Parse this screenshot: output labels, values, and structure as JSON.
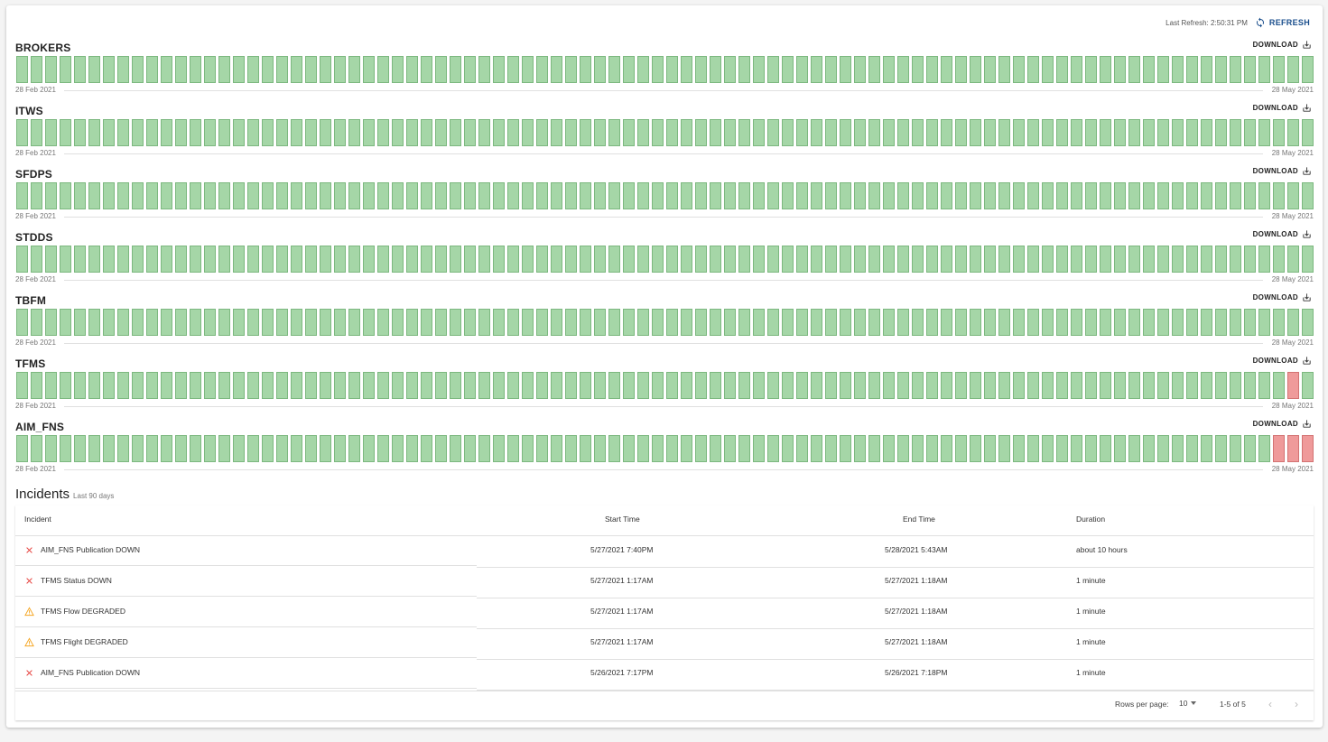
{
  "header": {
    "last_refresh_label": "Last Refresh: 2:50:31 PM",
    "refresh_label": "REFRESH",
    "refresh_icon": "refresh-icon"
  },
  "download_label": "DOWNLOAD",
  "download_icon": "download-icon",
  "status_colors": {
    "up": "#a5d6a7",
    "down": "#ef9a9a",
    "accent": "#1a4e8c"
  },
  "days_shown": 90,
  "services": [
    {
      "name": "BROKERS",
      "start_date": "28 Feb 2021",
      "end_date": "28 May 2021",
      "down_days": []
    },
    {
      "name": "ITWS",
      "start_date": "28 Feb 2021",
      "end_date": "28 May 2021",
      "down_days": []
    },
    {
      "name": "SFDPS",
      "start_date": "28 Feb 2021",
      "end_date": "28 May 2021",
      "down_days": []
    },
    {
      "name": "STDDS",
      "start_date": "28 Feb 2021",
      "end_date": "28 May 2021",
      "down_days": []
    },
    {
      "name": "TBFM",
      "start_date": "28 Feb 2021",
      "end_date": "28 May 2021",
      "down_days": []
    },
    {
      "name": "TFMS",
      "start_date": "28 Feb 2021",
      "end_date": "28 May 2021",
      "down_days": [
        88
      ]
    },
    {
      "name": "AIM_FNS",
      "start_date": "28 Feb 2021",
      "end_date": "28 May 2021",
      "down_days": [
        87,
        88,
        89
      ]
    }
  ],
  "incidents": {
    "title": "Incidents",
    "subtitle": "Last 90 days",
    "columns": [
      "Incident",
      "Start Time",
      "End Time",
      "Duration"
    ],
    "rows": [
      {
        "icon": "error-x-icon",
        "incident": "AIM_FNS Publication DOWN",
        "start": "5/27/2021 7:40PM",
        "end": "5/28/2021 5:43AM",
        "duration": "about 10 hours"
      },
      {
        "icon": "error-x-icon",
        "incident": "TFMS Status DOWN",
        "start": "5/27/2021 1:17AM",
        "end": "5/27/2021 1:18AM",
        "duration": "1 minute"
      },
      {
        "icon": "warning-icon",
        "incident": "TFMS Flow DEGRADED",
        "start": "5/27/2021 1:17AM",
        "end": "5/27/2021 1:18AM",
        "duration": "1 minute"
      },
      {
        "icon": "warning-icon",
        "incident": "TFMS Flight DEGRADED",
        "start": "5/27/2021 1:17AM",
        "end": "5/27/2021 1:18AM",
        "duration": "1 minute"
      },
      {
        "icon": "error-x-icon",
        "incident": "AIM_FNS Publication DOWN",
        "start": "5/26/2021 7:17PM",
        "end": "5/26/2021 7:18PM",
        "duration": "1 minute"
      }
    ],
    "footer": {
      "rows_per_page_label": "Rows per page:",
      "rows_per_page_value": "10",
      "range_label": "1-5 of 5"
    }
  }
}
